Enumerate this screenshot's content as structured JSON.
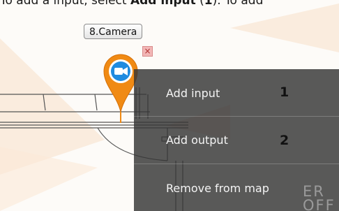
{
  "doc": {
    "prefix": "To add a input, select ",
    "bold_action": "Add input",
    "open": " (",
    "bold_num": "1",
    "suffix": "). To add"
  },
  "camera": {
    "label": "8.Camera",
    "icon": "video-camera-icon",
    "pin_color": "#f08a14",
    "icon_color": "#1f8be0"
  },
  "close_icon": "close-icon",
  "context_menu": {
    "items": [
      {
        "label": "Add input",
        "callout": "1"
      },
      {
        "label": "Add output",
        "callout": "2"
      },
      {
        "label": "Remove from map"
      }
    ]
  },
  "map": {
    "floor_text_top": "ER",
    "floor_text_bottom": "OFF"
  },
  "colors": {
    "watermark": "#f7dcc0",
    "menu_bg": "#343434"
  }
}
